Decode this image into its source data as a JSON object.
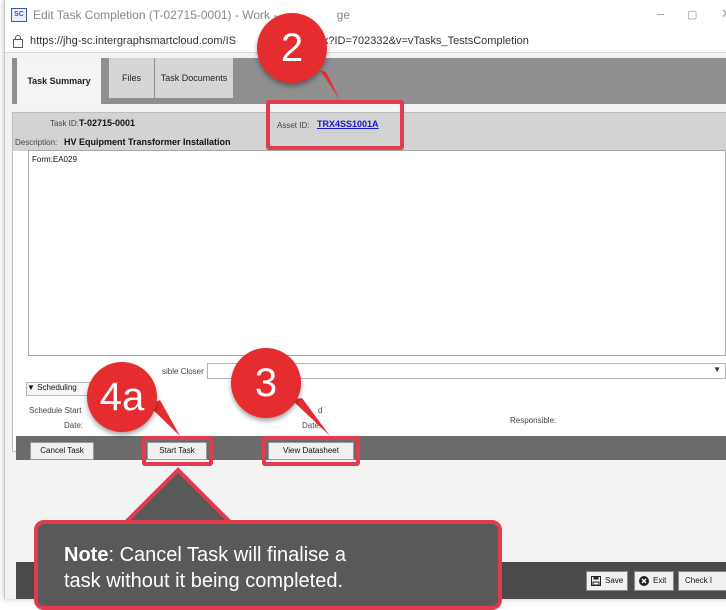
{
  "window": {
    "app_icon": "SC",
    "title": "Edit Task Completion (T-02715-0001) - Work - ",
    "title_tail": "ge",
    "minimize": "–",
    "maximize": "▢",
    "close": "✕"
  },
  "browser": {
    "url_prefix": "https://jhg-sc.intergraphsmartcloud.com/IS",
    "url_suffix": ".aspx?ID=702332&v=vTasks_TestsCompletion"
  },
  "tabs": [
    {
      "label": "Task Summary",
      "active": true
    },
    {
      "label": "Files",
      "active": false
    },
    {
      "label": "Task Documents",
      "active": false
    }
  ],
  "task": {
    "task_id_label": "Task ID:",
    "task_id": "T-02715-0001",
    "description_label": "Description:",
    "description": "HV Equipment Transformer Installation",
    "asset_id_label": "Asset ID:",
    "asset_id": "TRX4SS1001A",
    "notes": "Form:EA029"
  },
  "closer": {
    "label": "sible Closer",
    "arrow": "▼"
  },
  "scheduling": {
    "toggle": "▼ Scheduling",
    "start_label_1": "Schedule Start",
    "start_label_2": "Date:",
    "end_label_1": "d",
    "end_label_2": "Date:",
    "responsible_label": "Responsible:"
  },
  "actions": {
    "cancel": "Cancel Task",
    "start": "Start Task",
    "datasheet": "View Datasheet"
  },
  "footer": {
    "save": "Save",
    "exit": "Exit",
    "check": "Check I"
  },
  "callouts": {
    "c2": "2",
    "c3": "3",
    "c4a": "4a"
  },
  "note": {
    "bold": "Note",
    "text_1": ": Cancel Task will finalise a",
    "text_2": "task without it being completed."
  },
  "colors": {
    "highlight": "#e23b50",
    "callout": "#e52d2f",
    "link": "#1a1acc"
  }
}
